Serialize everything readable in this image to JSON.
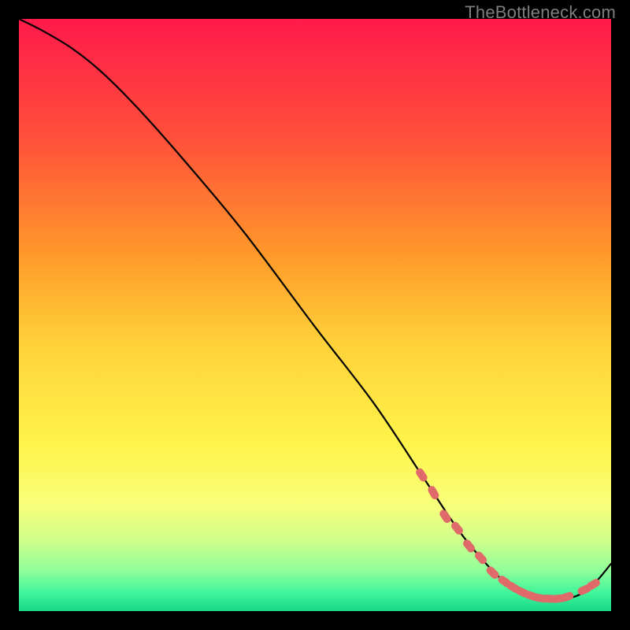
{
  "watermark": "TheBottleneck.com",
  "chart_data": {
    "type": "line",
    "title": "",
    "xlabel": "",
    "ylabel": "",
    "xlim": [
      0,
      100
    ],
    "ylim": [
      0,
      100
    ],
    "grid": false,
    "legend": false,
    "background_gradient": {
      "stops": [
        {
          "offset": 0.0,
          "color": "#ff1a4b"
        },
        {
          "offset": 0.2,
          "color": "#ff4f3a"
        },
        {
          "offset": 0.4,
          "color": "#ff9a2a"
        },
        {
          "offset": 0.55,
          "color": "#ffd23a"
        },
        {
          "offset": 0.72,
          "color": "#fff44a"
        },
        {
          "offset": 0.82,
          "color": "#f9ff7a"
        },
        {
          "offset": 0.88,
          "color": "#d0ff8a"
        },
        {
          "offset": 0.93,
          "color": "#92ff9a"
        },
        {
          "offset": 0.97,
          "color": "#3ef59a"
        },
        {
          "offset": 1.0,
          "color": "#17d885"
        }
      ]
    },
    "series": [
      {
        "name": "curve",
        "color": "#000000",
        "x": [
          0,
          4,
          9,
          14,
          20,
          28,
          38,
          50,
          60,
          68,
          74,
          78,
          82,
          86,
          90,
          94,
          97,
          100
        ],
        "y": [
          100,
          98,
          95,
          91,
          85,
          76,
          64,
          48,
          35,
          23,
          14,
          9,
          5,
          3,
          2,
          2.5,
          4.5,
          8
        ]
      }
    ],
    "markers": {
      "name": "bottleneck-band",
      "color": "#e06a6a",
      "points": [
        {
          "x": 68,
          "y": 23
        },
        {
          "x": 70,
          "y": 20
        },
        {
          "x": 72,
          "y": 16
        },
        {
          "x": 74,
          "y": 14
        },
        {
          "x": 76,
          "y": 11
        },
        {
          "x": 78,
          "y": 9
        },
        {
          "x": 80,
          "y": 6.5
        },
        {
          "x": 82,
          "y": 5
        },
        {
          "x": 83.5,
          "y": 4
        },
        {
          "x": 85,
          "y": 3.2
        },
        {
          "x": 86.5,
          "y": 2.6
        },
        {
          "x": 88,
          "y": 2.2
        },
        {
          "x": 89.5,
          "y": 2.1
        },
        {
          "x": 91,
          "y": 2.1
        },
        {
          "x": 92.5,
          "y": 2.4
        },
        {
          "x": 95.5,
          "y": 3.6
        },
        {
          "x": 97,
          "y": 4.5
        }
      ]
    }
  }
}
